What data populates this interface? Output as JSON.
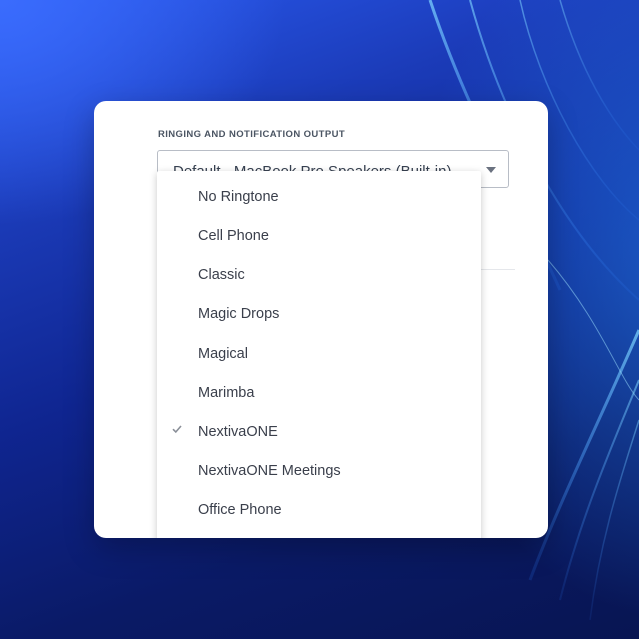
{
  "settings": {
    "section_label": "RINGING AND NOTIFICATION OUTPUT",
    "output_select_value": "Default - MacBook Pro Speakers (Built-in)",
    "select_arrow_icon": "chevron-down-icon"
  },
  "ringtone_dropdown": {
    "options": [
      {
        "label": "No Ringtone",
        "selected": false
      },
      {
        "label": "Cell Phone",
        "selected": false
      },
      {
        "label": "Classic",
        "selected": false
      },
      {
        "label": "Magic Drops",
        "selected": false
      },
      {
        "label": "Magical",
        "selected": false
      },
      {
        "label": "Marimba",
        "selected": false
      },
      {
        "label": "NextivaONE",
        "selected": true
      },
      {
        "label": "NextivaONE Meetings",
        "selected": false
      },
      {
        "label": "Office Phone",
        "selected": false
      }
    ],
    "check_icon": "checkmark-icon"
  },
  "colors": {
    "background_primary": "#1b3bb8",
    "card": "#ffffff",
    "text": "#3a3f4b"
  }
}
